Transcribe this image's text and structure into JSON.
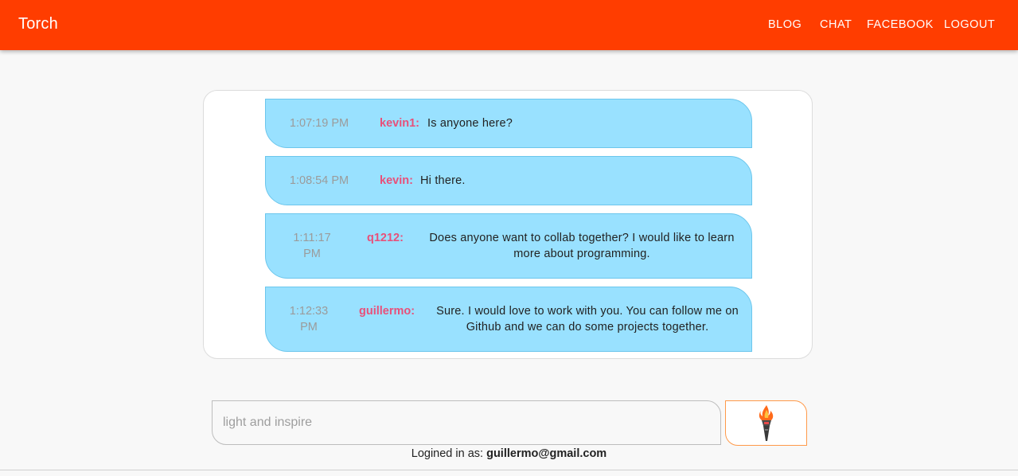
{
  "header": {
    "brand": "Torch",
    "nav": [
      {
        "label": "BLOG"
      },
      {
        "label": "CHAT"
      },
      {
        "label": "FACEBOOK"
      },
      {
        "label": "LOGOUT"
      }
    ]
  },
  "messages": [
    {
      "time": "1:07:19 PM",
      "user": "kevin1:",
      "text": "Is anyone here?"
    },
    {
      "time": "1:08:54 PM",
      "user": "kevin:",
      "text": "Hi there."
    },
    {
      "time": "1:11:17 PM",
      "user": "q1212:",
      "text": "Does anyone want to collab together? I would like to learn more about programming."
    },
    {
      "time": "1:12:33 PM",
      "user": "guillermo:",
      "text": "Sure. I would love to work with you. You can follow me on Github and we can do some projects together."
    }
  ],
  "composer": {
    "placeholder": "light and inspire",
    "value": "",
    "send_icon": "torch-icon"
  },
  "footer": {
    "login_prefix": "Logined in as:",
    "login_email": "guillermo@gmail.com"
  },
  "colors": {
    "header_bg": "#ff3d00",
    "bubble_bg": "#99e1ff",
    "username": "#e8507a",
    "send_border": "#ff9a4a"
  }
}
